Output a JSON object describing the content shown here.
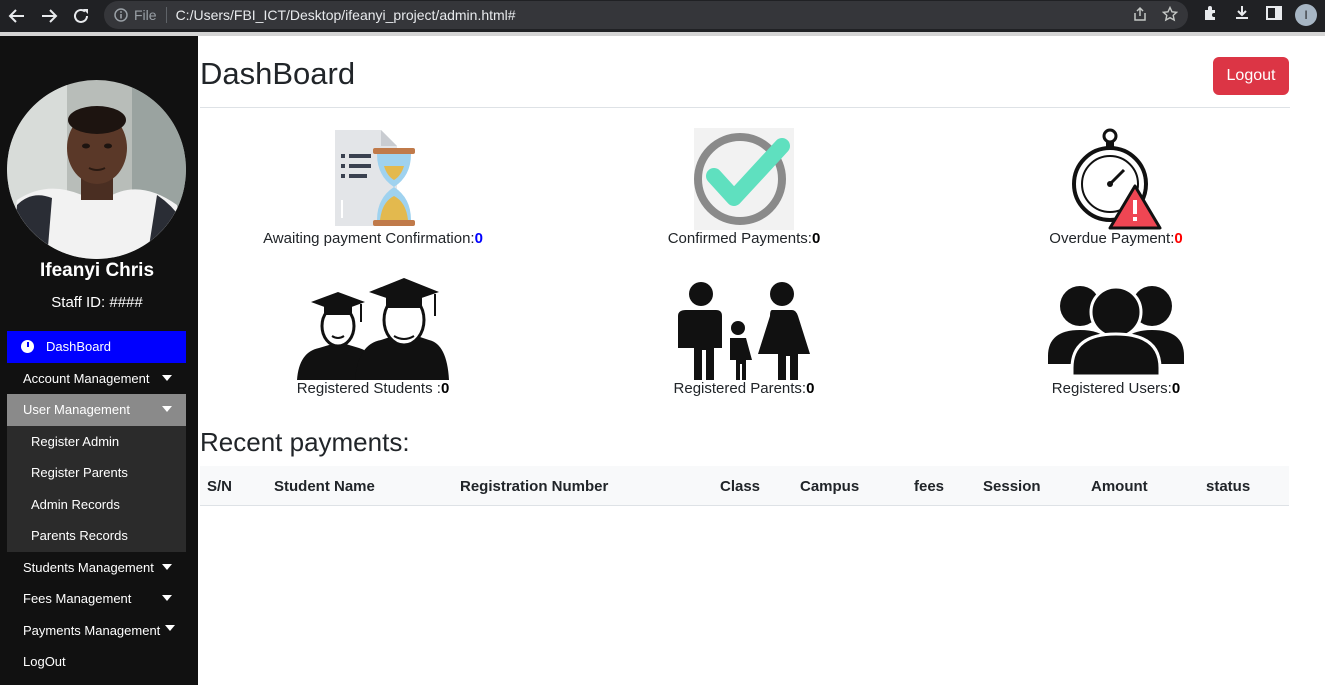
{
  "browser": {
    "file_label": "File",
    "url": "C:/Users/FBI_ICT/Desktop/ifeanyi_project/admin.html#",
    "profile_initial": "I"
  },
  "sidebar": {
    "name": "Ifeanyi Chris",
    "staff_id": "Staff ID: ####",
    "items": [
      {
        "label": "DashBoard",
        "icon": "dashboard-icon"
      },
      {
        "label": "Account Management",
        "icon": "chevron-down-icon"
      },
      {
        "label": "User Management",
        "icon": "chevron-down-icon"
      },
      {
        "label": "Register Admin"
      },
      {
        "label": "Register Parents"
      },
      {
        "label": "Admin Records"
      },
      {
        "label": "Parents Records"
      },
      {
        "label": "Students Management",
        "icon": "chevron-down-icon"
      },
      {
        "label": "Fees Management",
        "icon": "chevron-down-icon"
      },
      {
        "label": "Payments Management",
        "icon": "chevron-down-icon"
      },
      {
        "label": "LogOut"
      }
    ]
  },
  "header": {
    "title": "DashBoard",
    "logout": "Logout"
  },
  "stats": [
    {
      "label": "Awaiting payment Confirmation: ",
      "value": "0",
      "value_color": "#0000ff",
      "icon": "hourglass-document-icon"
    },
    {
      "label": "Confirmed Payments: ",
      "value": "0",
      "value_color": "#000000",
      "icon": "checkmark-icon"
    },
    {
      "label": "Overdue Payment: ",
      "value": "0",
      "value_color": "#ff0000",
      "icon": "stopwatch-warning-icon"
    },
    {
      "label": "Registered Students : ",
      "value": "0",
      "value_color": "#000000",
      "icon": "graduates-icon"
    },
    {
      "label": "Registered Parents: ",
      "value": "0",
      "value_color": "#000000",
      "icon": "family-icon"
    },
    {
      "label": "Registered Users: ",
      "value": "0",
      "value_color": "#000000",
      "icon": "users-group-icon"
    }
  ],
  "recent": {
    "title": "Recent payments:",
    "columns": [
      "S/N",
      "Student Name",
      "Registration Number",
      "Class",
      "Campus",
      "fees",
      "Session",
      "Amount",
      "status"
    ]
  },
  "colors": {
    "sidebar_bg": "#111111",
    "active_item": "#0000ff",
    "logout_btn": "#dc3545"
  }
}
